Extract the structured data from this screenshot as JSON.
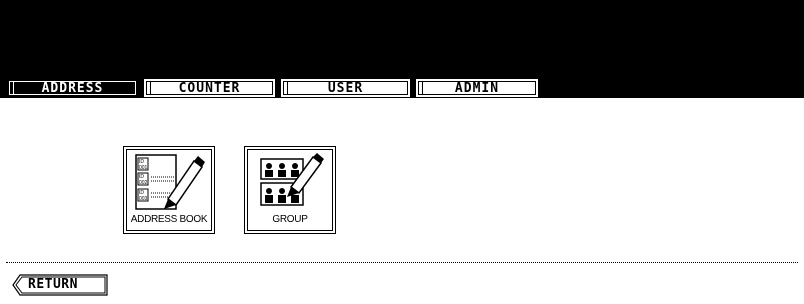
{
  "tabs": [
    {
      "label": "ADDRESS",
      "active": true
    },
    {
      "label": "COUNTER",
      "active": false
    },
    {
      "label": "USER",
      "active": false
    },
    {
      "label": "ADMIN",
      "active": false
    }
  ],
  "buttons": {
    "address_book": {
      "label": "ADDRESS BOOK",
      "icon": "address-book-icon"
    },
    "group": {
      "label": "GROUP",
      "icon": "group-icon"
    }
  },
  "footer": {
    "return_label": "RETURN"
  },
  "icon_text": {
    "id1": "ID 001",
    "id2": "ID 002",
    "id3": "ID 003"
  }
}
